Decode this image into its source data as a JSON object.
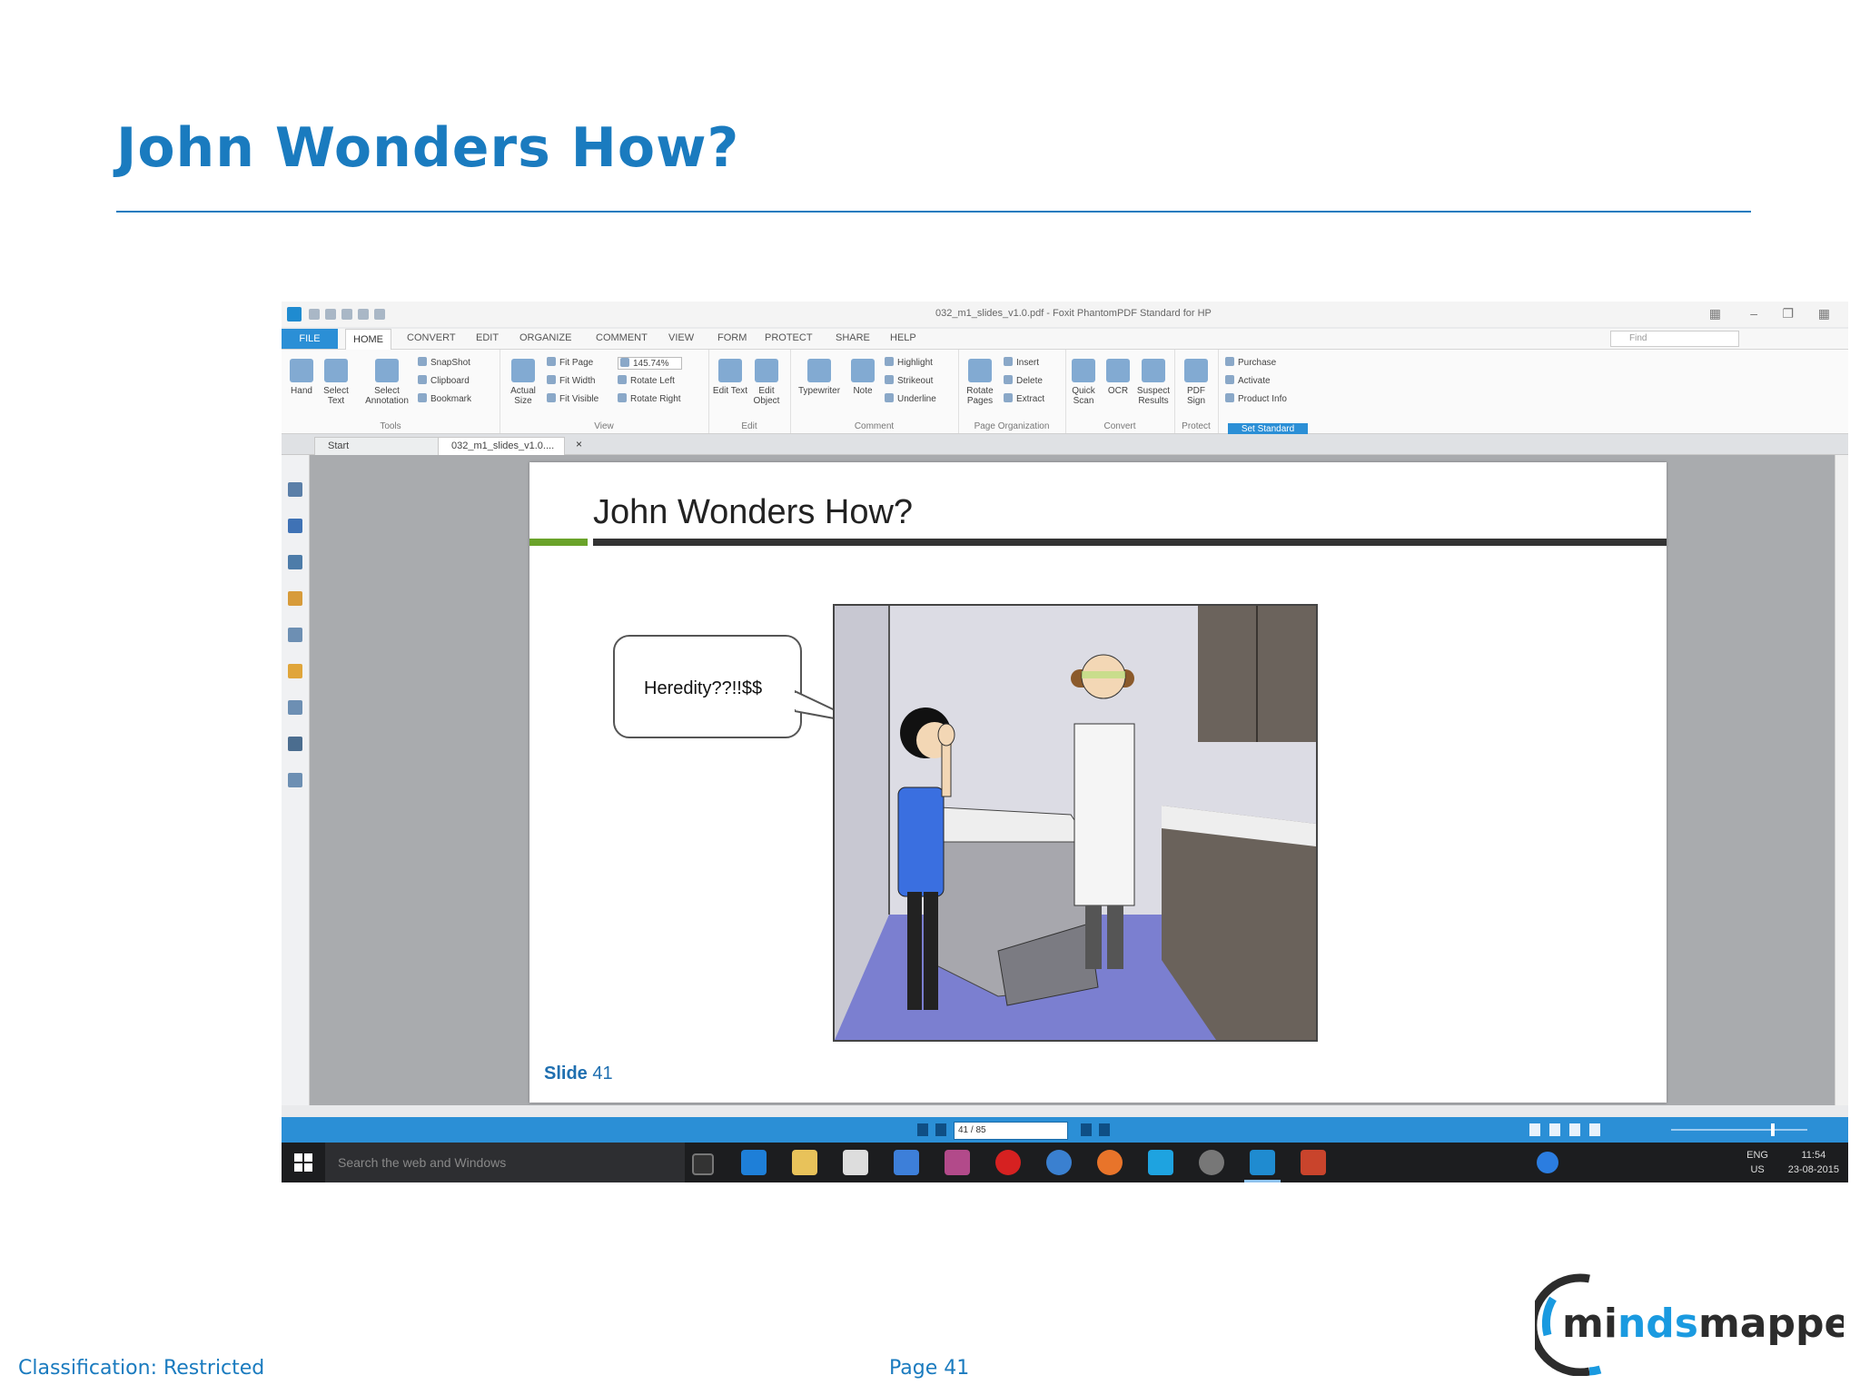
{
  "slide": {
    "title": "John Wonders How?",
    "footer_classification": "Classification: Restricted",
    "footer_page": "Page 41",
    "logo_text": "mindsmapped"
  },
  "app": {
    "window_title": "032_m1_slides_v1.0.pdf - Foxit PhantomPDF Standard for HP",
    "menu": [
      "FILE",
      "HOME",
      "CONVERT",
      "EDIT",
      "ORGANIZE",
      "COMMENT",
      "VIEW",
      "FORM",
      "PROTECT",
      "SHARE",
      "HELP"
    ],
    "find_placeholder": "Find",
    "ribbon": {
      "tools": {
        "hand": "Hand",
        "select_text": "Select Text",
        "select_annotation": "Select Annotation",
        "snapshot": "SnapShot",
        "clipboard": "Clipboard",
        "bookmark": "Bookmark",
        "caption": "Tools"
      },
      "view": {
        "actual_size": "Actual Size",
        "fit_page": "Fit Page",
        "fit_width": "Fit Width",
        "fit_visible": "Fit Visible",
        "zoom": "145.74%",
        "rotate_left": "Rotate Left",
        "rotate_right": "Rotate Right",
        "caption": "View"
      },
      "edit": {
        "edit_text": "Edit Text",
        "edit_object": "Edit Object",
        "caption": "Edit"
      },
      "comment": {
        "typewriter": "Typewriter",
        "note": "Note",
        "highlight": "Highlight",
        "strikeout": "Strikeout",
        "underline": "Underline",
        "caption": "Comment"
      },
      "page_org": {
        "rotate_pages": "Rotate Pages",
        "insert": "Insert",
        "delete": "Delete",
        "extract": "Extract",
        "caption": "Page Organization"
      },
      "convert": {
        "quick_scan": "Quick Scan",
        "ocr": "OCR",
        "suspect_results": "Suspect Results",
        "caption": "Convert"
      },
      "protect": {
        "pdf_sign": "PDF Sign",
        "caption": "Protect"
      },
      "purchase": {
        "purchase": "Purchase",
        "activate": "Activate",
        "product_info": "Product Info",
        "set_standard": "Set Standard"
      }
    },
    "tabs": [
      "Start",
      "032_m1_slides_v1.0...."
    ],
    "page": {
      "title": "John Wonders How?",
      "bubble": "Heredity??!!$$",
      "slide_label": "Slide",
      "slide_number": "41"
    },
    "page_indicator": "41 / 85",
    "taskbar": {
      "search": "Search the web and Windows",
      "lang_top": "ENG",
      "lang_bottom": "US",
      "time": "11:54",
      "date": "23-08-2015"
    }
  }
}
